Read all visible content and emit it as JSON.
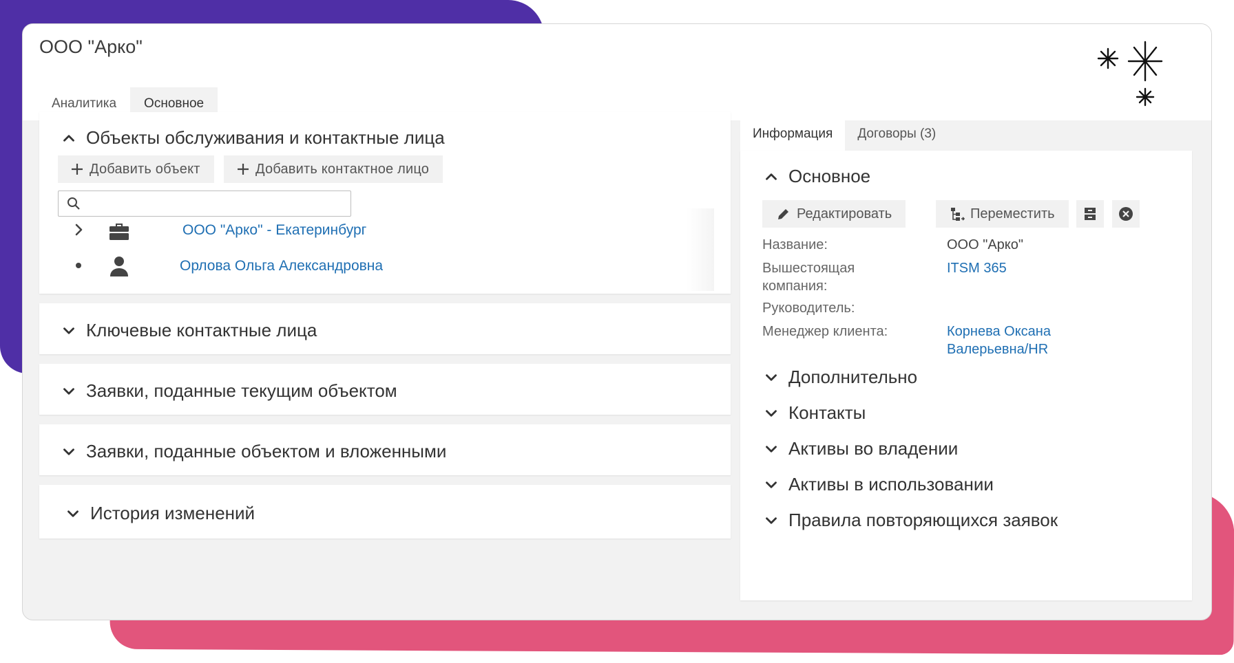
{
  "window": {
    "title": "ООО \"Арко\""
  },
  "main_tabs": [
    {
      "label": "Аналитика",
      "active": false
    },
    {
      "label": "Основное",
      "active": true
    }
  ],
  "objects_card": {
    "title": "Объекты обслуживания и контактные лица",
    "add_object_label": "Добавить объект",
    "add_contact_label": "Добавить контактное лицо",
    "search_placeholder": "",
    "rows": [
      {
        "icon": "briefcase-icon",
        "expander": "chevron-right-icon",
        "label": "ООО \"Арко\" - Екатеринбург"
      },
      {
        "icon": "person-icon",
        "expander": "bullet-icon",
        "label": "Орлова Ольга Александровна"
      }
    ]
  },
  "sections": [
    {
      "title": "Ключевые контактные лица"
    },
    {
      "title": "Заявки, поданные текущим объектом"
    },
    {
      "title": "Заявки, поданные объектом и вложенными"
    },
    {
      "title": "История изменений"
    }
  ],
  "right_panel": {
    "tabs": [
      {
        "label": "Информация",
        "active": true
      },
      {
        "label": "Договоры (3)",
        "active": false
      }
    ],
    "main_section_title": "Основное",
    "edit_label": "Редактировать",
    "move_label": "Переместить",
    "fields": [
      {
        "label": "Название:",
        "value": "ООО \"Арко\"",
        "is_link": false
      },
      {
        "label": "Вышестоящая компания:",
        "value": "ITSM 365",
        "is_link": true
      },
      {
        "label": "Руководитель:",
        "value": "",
        "is_link": false
      },
      {
        "label": "Менеджер клиента:",
        "value": "Корнева Оксана Валерьевна/HR",
        "is_link": true
      }
    ],
    "collapsed_sections": [
      {
        "title": "Дополнительно"
      },
      {
        "title": "Контакты"
      },
      {
        "title": "Активы во владении"
      },
      {
        "title": "Активы в использовании"
      },
      {
        "title": "Правила повторяющихся заявок"
      }
    ]
  },
  "colors": {
    "accent_purple": "#4f2fa6",
    "accent_pink": "#e2557c",
    "link": "#1f6fb3"
  }
}
